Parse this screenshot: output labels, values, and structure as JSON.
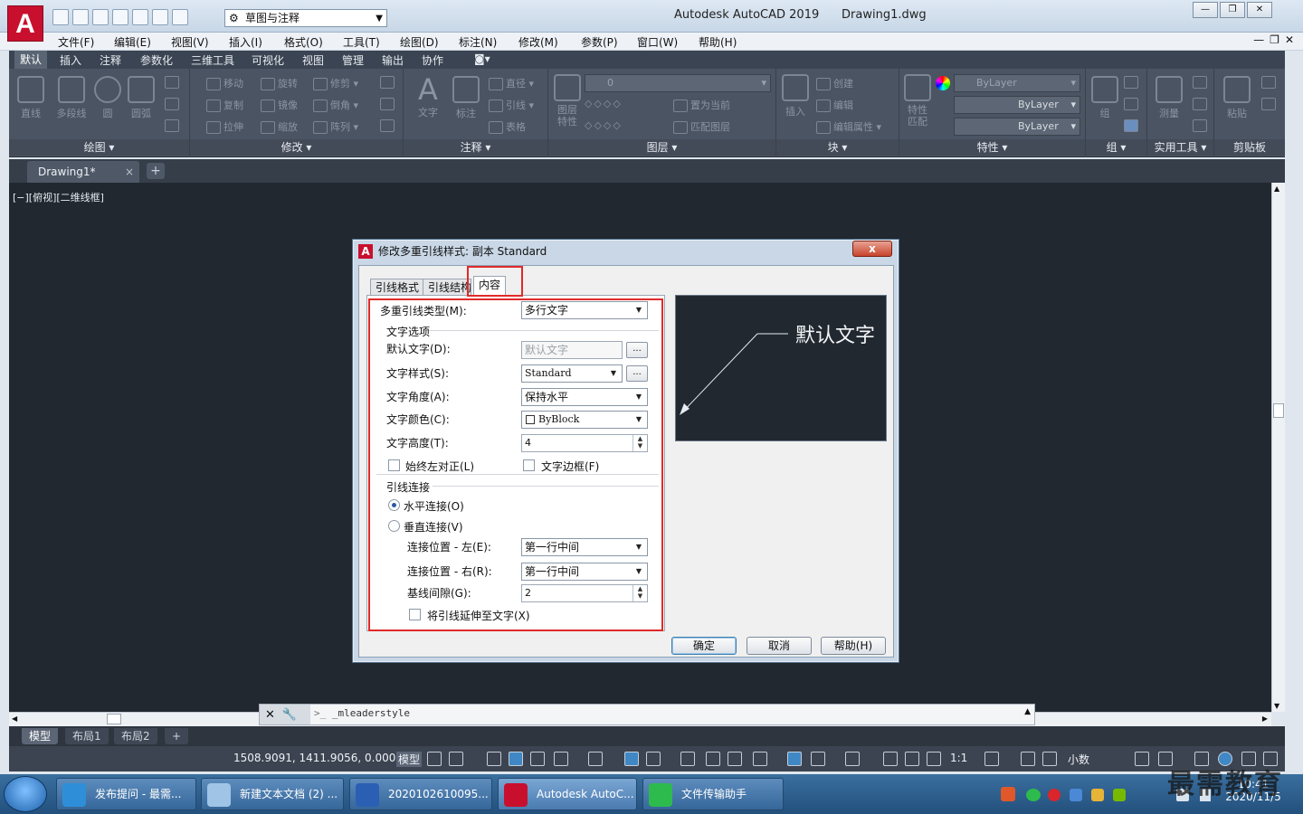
{
  "app": {
    "logo_letter": "A",
    "workspace": "草图与注释",
    "window_title": "Autodesk AutoCAD 2019",
    "document_name": "Drawing1.dwg"
  },
  "menubar": [
    "文件(F)",
    "编辑(E)",
    "视图(V)",
    "插入(I)",
    "格式(O)",
    "工具(T)",
    "绘图(D)",
    "标注(N)",
    "修改(M)",
    "参数(P)",
    "窗口(W)",
    "帮助(H)"
  ],
  "ribbon_tabs": [
    "默认",
    "插入",
    "注释",
    "参数化",
    "三维工具",
    "可视化",
    "视图",
    "管理",
    "输出",
    "协作"
  ],
  "ribbon": {
    "draw": {
      "title": "绘图",
      "line": "直线",
      "polyline": "多段线",
      "circle": "圆",
      "arc": "圆弧"
    },
    "modify": {
      "title": "修改",
      "move": "移动",
      "rotate": "旋转",
      "trim": "修剪",
      "copy": "复制",
      "mirror": "镜像",
      "fillet": "倒角",
      "stretch": "拉伸",
      "scale": "缩放",
      "array": "阵列"
    },
    "annotation": {
      "title": "注释",
      "text": "文字",
      "dimension": "标注",
      "radius": "直径",
      "leader": "引线",
      "table": "表格"
    },
    "layers": {
      "title": "图层",
      "layer_props": "图层\n特性",
      "current_layer": "0",
      "make_current": "置为当前",
      "match_layer": "匹配图层"
    },
    "block": {
      "title": "块",
      "insert": "插入",
      "create": "创建",
      "edit": "编辑",
      "edit_attr": "编辑属性"
    },
    "properties": {
      "title": "特性",
      "match": "特性\n匹配",
      "color": "ByLayer",
      "linetype": "ByLayer",
      "lineweight": "ByLayer"
    },
    "groups": {
      "title": "组",
      "group": "组"
    },
    "utilities": {
      "title": "实用工具",
      "measure": "测量"
    },
    "clipboard": {
      "title": "剪贴板",
      "paste": "粘贴"
    }
  },
  "doc_tab": {
    "label": "Drawing1*",
    "close": "×",
    "add": "+"
  },
  "viewport_label": "[−][俯视][二维线框]",
  "dialog": {
    "title": "修改多重引线样式: 副本 Standard",
    "close": "x",
    "tabs": [
      "引线格式",
      "引线结构",
      "内容"
    ],
    "leader_type_label": "多重引线类型(M):",
    "leader_type_value": "多行文字",
    "text_options_header": "文字选项",
    "default_text_label": "默认文字(D):",
    "default_text_value": "默认文字",
    "text_style_label": "文字样式(S):",
    "text_style_value": "Standard",
    "text_angle_label": "文字角度(A):",
    "text_angle_value": "保持水平",
    "text_color_label": "文字颜色(C):",
    "text_color_value": "ByBlock",
    "text_height_label": "文字高度(T):",
    "text_height_value": "4",
    "always_left_label": "始终左对正(L)",
    "text_frame_label": "文字边框(F)",
    "leader_conn_header": "引线连接",
    "horizontal_label": "水平连接(O)",
    "vertical_label": "垂直连接(V)",
    "conn_left_label": "连接位置 - 左(E):",
    "conn_left_value": "第一行中间",
    "conn_right_label": "连接位置 - 右(R):",
    "conn_right_value": "第一行中间",
    "landing_gap_label": "基线间隙(G):",
    "landing_gap_value": "2",
    "extend_label": "将引线延伸至文字(X)",
    "preview_text": "默认文字",
    "ok": "确定",
    "cancel": "取消",
    "help": "帮助(H)",
    "ellipsis": "..."
  },
  "command_line": {
    "text": "_mleaderstyle",
    "prompt": ">_"
  },
  "layout_tabs": [
    "模型",
    "布局1",
    "布局2",
    "+"
  ],
  "statusbar": {
    "coords": "1508.9091, 1411.9056, 0.0000",
    "model": "模型",
    "scale": "1:1",
    "units": "小数"
  },
  "taskbar": {
    "items": [
      "发布提问 - 最需...",
      "新建文本文档 (2) ...",
      "2020102610095...",
      "Autodesk AutoC...",
      "文件传输助手"
    ],
    "time": "10:41",
    "date": "2020/11/5"
  },
  "watermark": "最需教育",
  "colors": {
    "accent_red": "#e02a2a",
    "canvas": "#212830",
    "ribbon": "#4b5463"
  }
}
